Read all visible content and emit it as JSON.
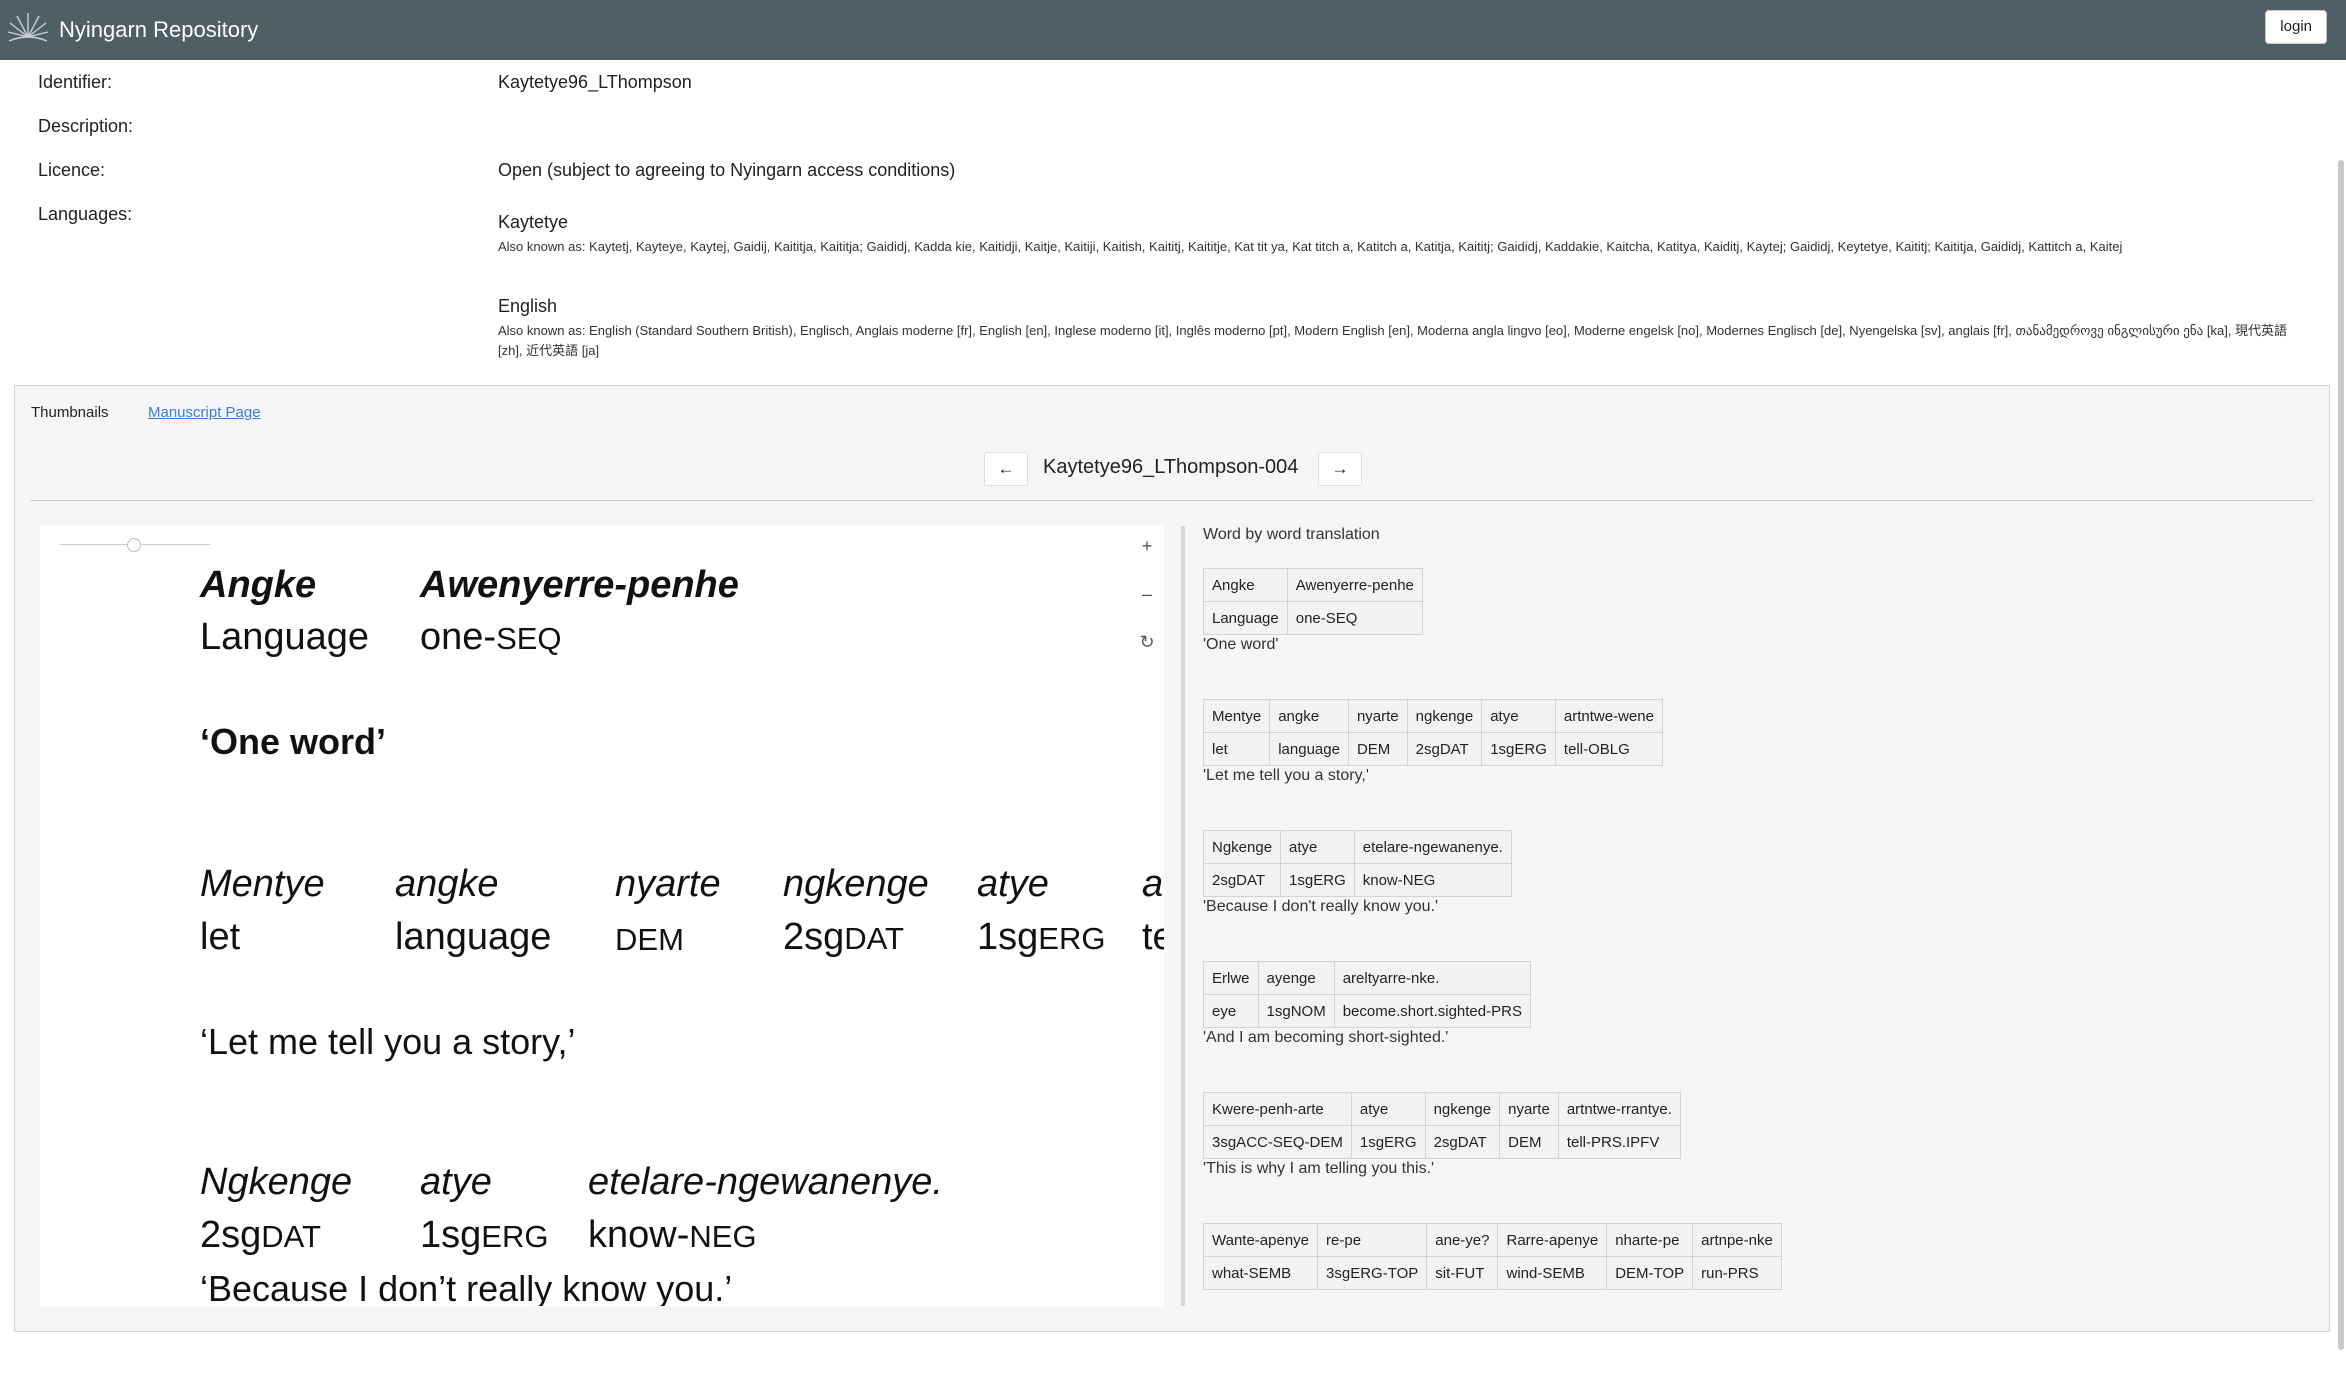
{
  "header": {
    "brand": "Nyingarn Repository",
    "login_label": "login",
    "bg_color": "#4f5f66"
  },
  "meta": {
    "identifier_label": "Identifier:",
    "identifier_value": "Kaytetye96_LThompson",
    "description_label": "Description:",
    "licence_label": "Licence:",
    "licence_value": "Open (subject to agreeing to Nyingarn access conditions)",
    "languages_label": "Languages:",
    "languages": [
      {
        "name": "Kaytetye",
        "aka": "Also known as: Kaytetj, Kayteye, Kaytej, Gaidij, Kaititja, Kaititja; Gaididj, Kadda kie, Kaitidji, Kaitje, Kaitiji, Kaitish, Kaititj, Kaititje, Kat tit ya, Kat titch a, Katitch a, Katitja, Kaititj; Gaididj, Kaddakie, Kaitcha, Katitya, Kaiditj, Kaytej; Gaididj, Keytetye, Kaititj; Kaititja, Gaididj, Kattitch a, Kaitej"
      },
      {
        "name": "English",
        "aka": "Also known as: English (Standard Southern British), Englisch, Anglais moderne [fr], English [en], Inglese moderno [it], Inglês moderno [pt], Modern English [en], Moderna angla lingvo [eo], Moderne engelsk [no], Modernes Englisch [de], Nyengelska [sv], anglais [fr], თანამედროვე ინგლისური ენა [ka], 現代英語 [zh], 近代英語 [ja]"
      }
    ]
  },
  "panel": {
    "tab_thumbnails": "Thumbnails",
    "tab_manuscript": "Manuscript Page",
    "prev_label": "←",
    "next_label": "→",
    "page_title": "Kaytetye96_LThompson-004"
  },
  "viewer": {
    "zoom_in": "+",
    "zoom_out": "–",
    "reset": "↻",
    "lines": [
      {
        "w1": "Angke",
        "w2": "Awenyerre-penhe",
        "g1": "Language",
        "g2a": "one-",
        "g2b": "SEQ",
        "tr": "‘One word’"
      },
      {
        "w1": "Mentye",
        "w2": "angke",
        "w3": "nyarte",
        "w4": "ngkenge",
        "w5": "atye",
        "w6": "a",
        "g1": "let",
        "g2": "language",
        "g3": "DEM",
        "g4a": "2sg",
        "g4b": "DAT",
        "g5a": "1sg",
        "g5b": "ERG",
        "g6": "te",
        "tr": "‘Let me tell you a story,’"
      },
      {
        "w1": "Ngkenge",
        "w2": "atye",
        "w3": "etelare-ngewanenye.",
        "g1a": "2sg",
        "g1b": "DAT",
        "g2a": "1sg",
        "g2b": "ERG",
        "g3a": "know-",
        "g3b": "NEG",
        "tr": "‘Because I don’t really know you.’"
      }
    ]
  },
  "translation": {
    "title": "Word by word translation",
    "blocks": [
      {
        "words": [
          "Angke",
          "Awenyerre-penhe"
        ],
        "gloss": [
          "Language",
          "one-SEQ"
        ],
        "free": "'One word'"
      },
      {
        "words": [
          "Mentye",
          "angke",
          "nyarte",
          "ngkenge",
          "atye",
          "artntwe-wene"
        ],
        "gloss": [
          "let",
          "language",
          "DEM",
          "2sgDAT",
          "1sgERG",
          "tell-OBLG"
        ],
        "free": "'Let me tell you a story,'"
      },
      {
        "words": [
          "Ngkenge",
          "atye",
          "etelare-ngewanenye."
        ],
        "gloss": [
          "2sgDAT",
          "1sgERG",
          "know-NEG"
        ],
        "free": "'Because I don't really know you.'"
      },
      {
        "words": [
          "Erlwe",
          "ayenge",
          "areltyarre-nke."
        ],
        "gloss": [
          "eye",
          "1sgNOM",
          "become.short.sighted-PRS"
        ],
        "free": "'And I am becoming short-sighted.'"
      },
      {
        "words": [
          "Kwere-penh-arte",
          "atye",
          "ngkenge",
          "nyarte",
          "artntwe-rrantye."
        ],
        "gloss": [
          "3sgACC-SEQ-DEM",
          "1sgERG",
          "2sgDAT",
          "DEM",
          "tell-PRS.IPFV"
        ],
        "free": "'This is why I am telling you this.'"
      },
      {
        "words": [
          "Wante-apenye",
          "re-pe",
          "ane-ye?",
          "Rarre-apenye",
          "nharte-pe",
          "artnpe-nke"
        ],
        "gloss": [
          "what-SEMB",
          "3sgERG-TOP",
          "sit-FUT",
          "wind-SEMB",
          "DEM-TOP",
          "run-PRS"
        ],
        "free": ""
      }
    ]
  }
}
